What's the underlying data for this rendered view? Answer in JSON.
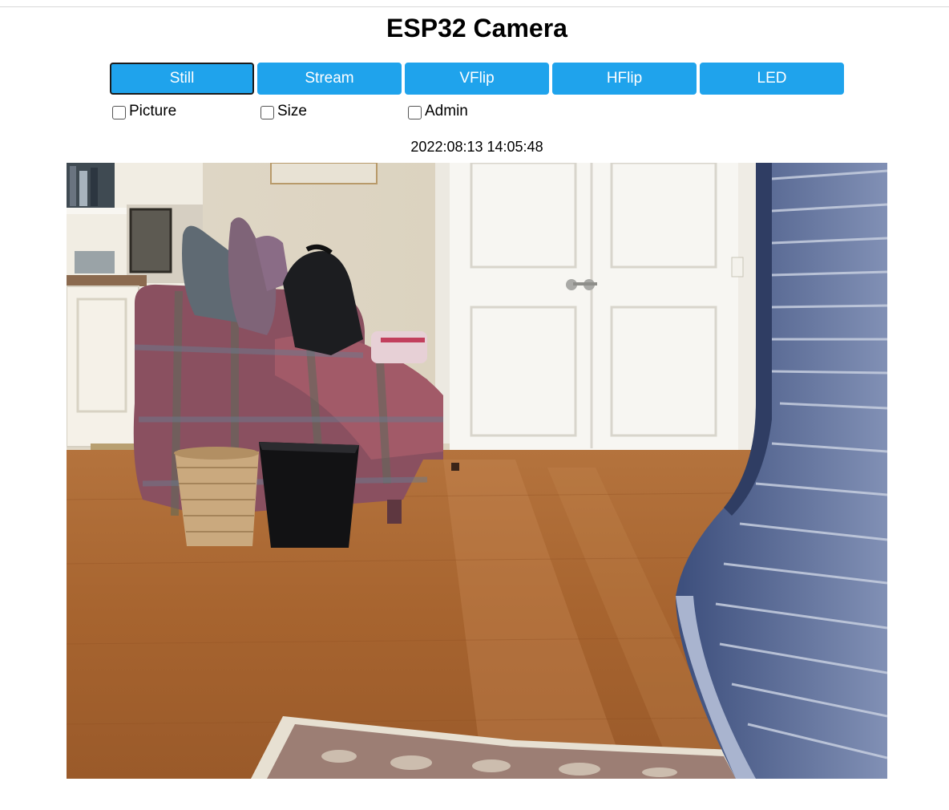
{
  "page": {
    "title": "ESP32 Camera"
  },
  "buttons": [
    {
      "label": "Still",
      "active": true
    },
    {
      "label": "Stream",
      "active": false
    },
    {
      "label": "VFlip",
      "active": false
    },
    {
      "label": "HFlip",
      "active": false
    },
    {
      "label": "LED",
      "active": false
    }
  ],
  "checkboxes": [
    {
      "label": "Picture",
      "checked": false
    },
    {
      "label": "Size",
      "checked": false
    },
    {
      "label": "Admin",
      "checked": false
    }
  ],
  "timestamp": "2022:08:13 14:05:48",
  "camera_image": {
    "subject": "room-interior-photo"
  },
  "colors": {
    "button_bg": "#1fa3ec",
    "button_text": "#ffffff",
    "active_border": "#1a1a1a"
  }
}
